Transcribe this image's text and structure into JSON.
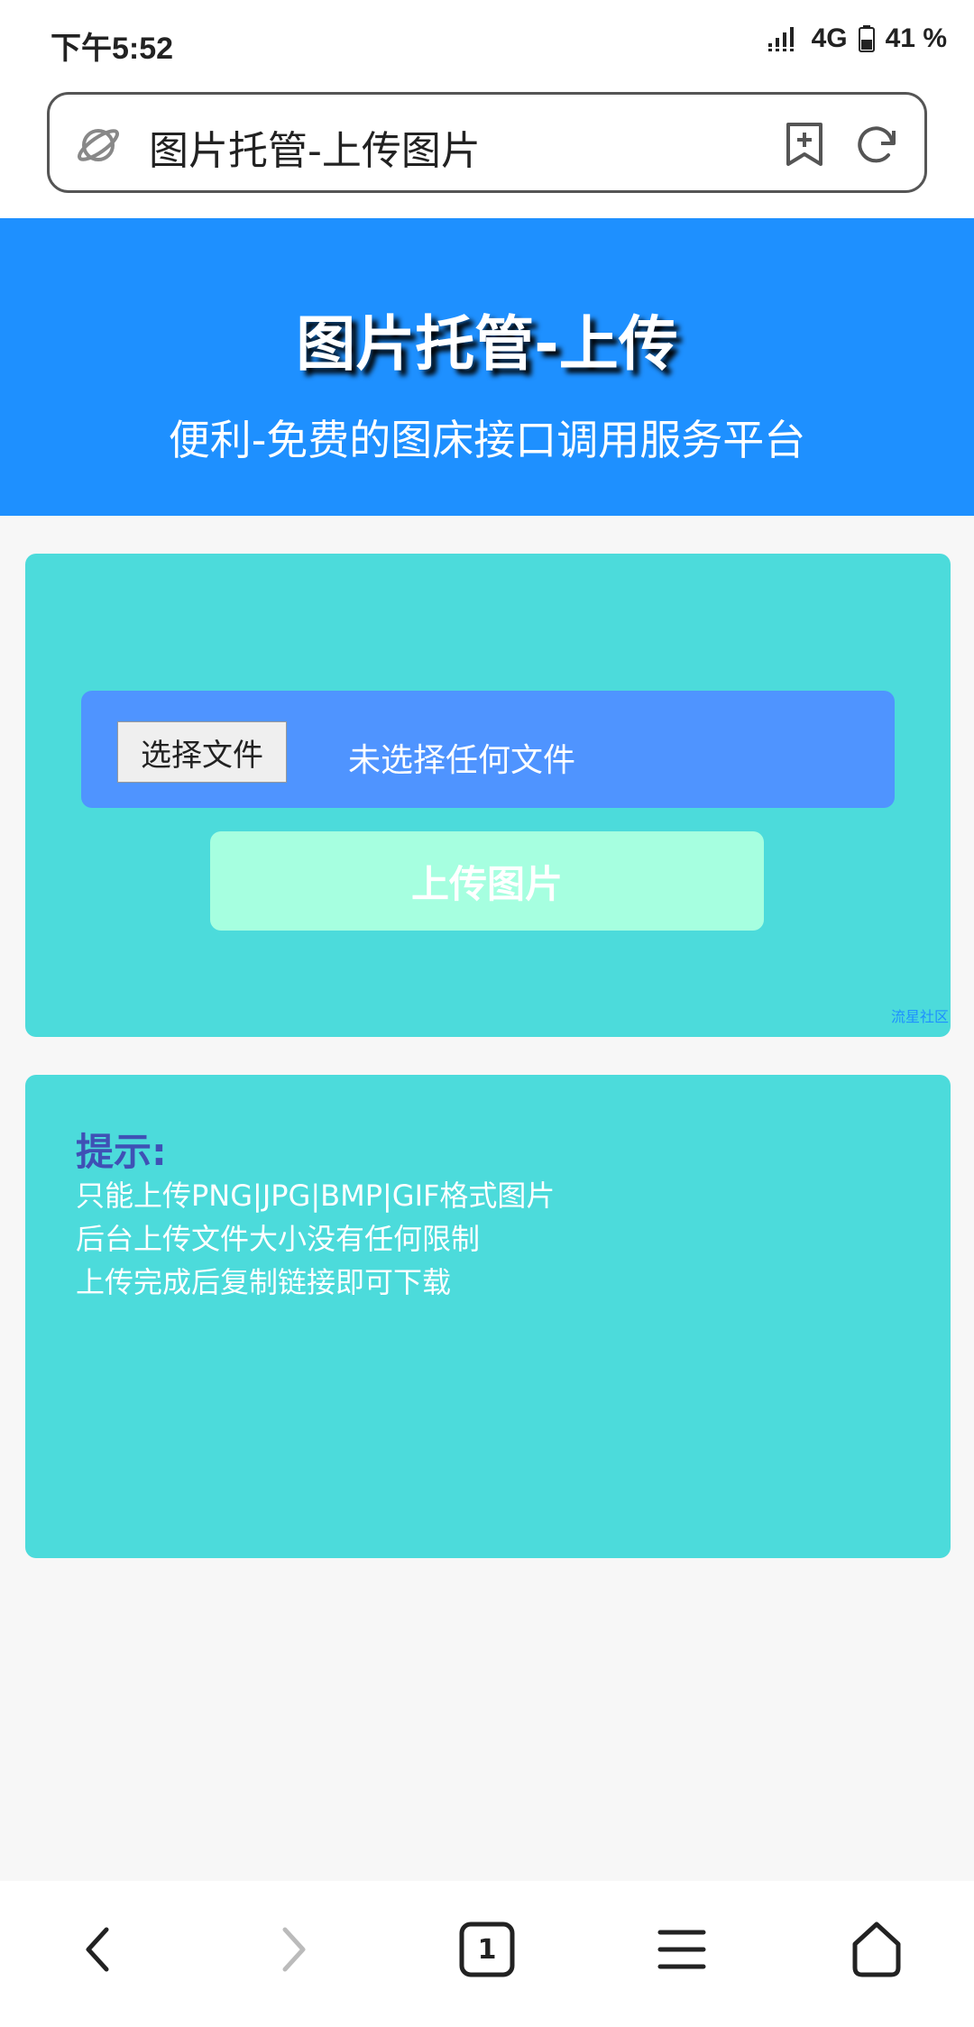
{
  "status_bar": {
    "time": "下午5:52",
    "network": "4G",
    "battery": "41 %"
  },
  "browser": {
    "url_text": "图片托管-上传图片",
    "tab_count": "1"
  },
  "banner": {
    "title": "图片托管-上传",
    "subtitle": "便利-免费的图床接口调用服务平台"
  },
  "upload": {
    "choose_file_label": "选择文件",
    "no_file_text": "未选择任何文件",
    "upload_button_label": "上传图片",
    "footer_link": "流星社区"
  },
  "tips": {
    "title": "提示:",
    "lines": [
      "只能上传PNG|JPG|BMP|GIF格式图片",
      "后台上传文件大小没有任何限制",
      "上传完成后复制链接即可下载"
    ]
  },
  "colors": {
    "banner": "#1e90ff",
    "card": "#4cdbdb",
    "file_row": "#4f94ff",
    "upload_button": "#a6ffe0",
    "tips_title": "#3f51b5"
  }
}
